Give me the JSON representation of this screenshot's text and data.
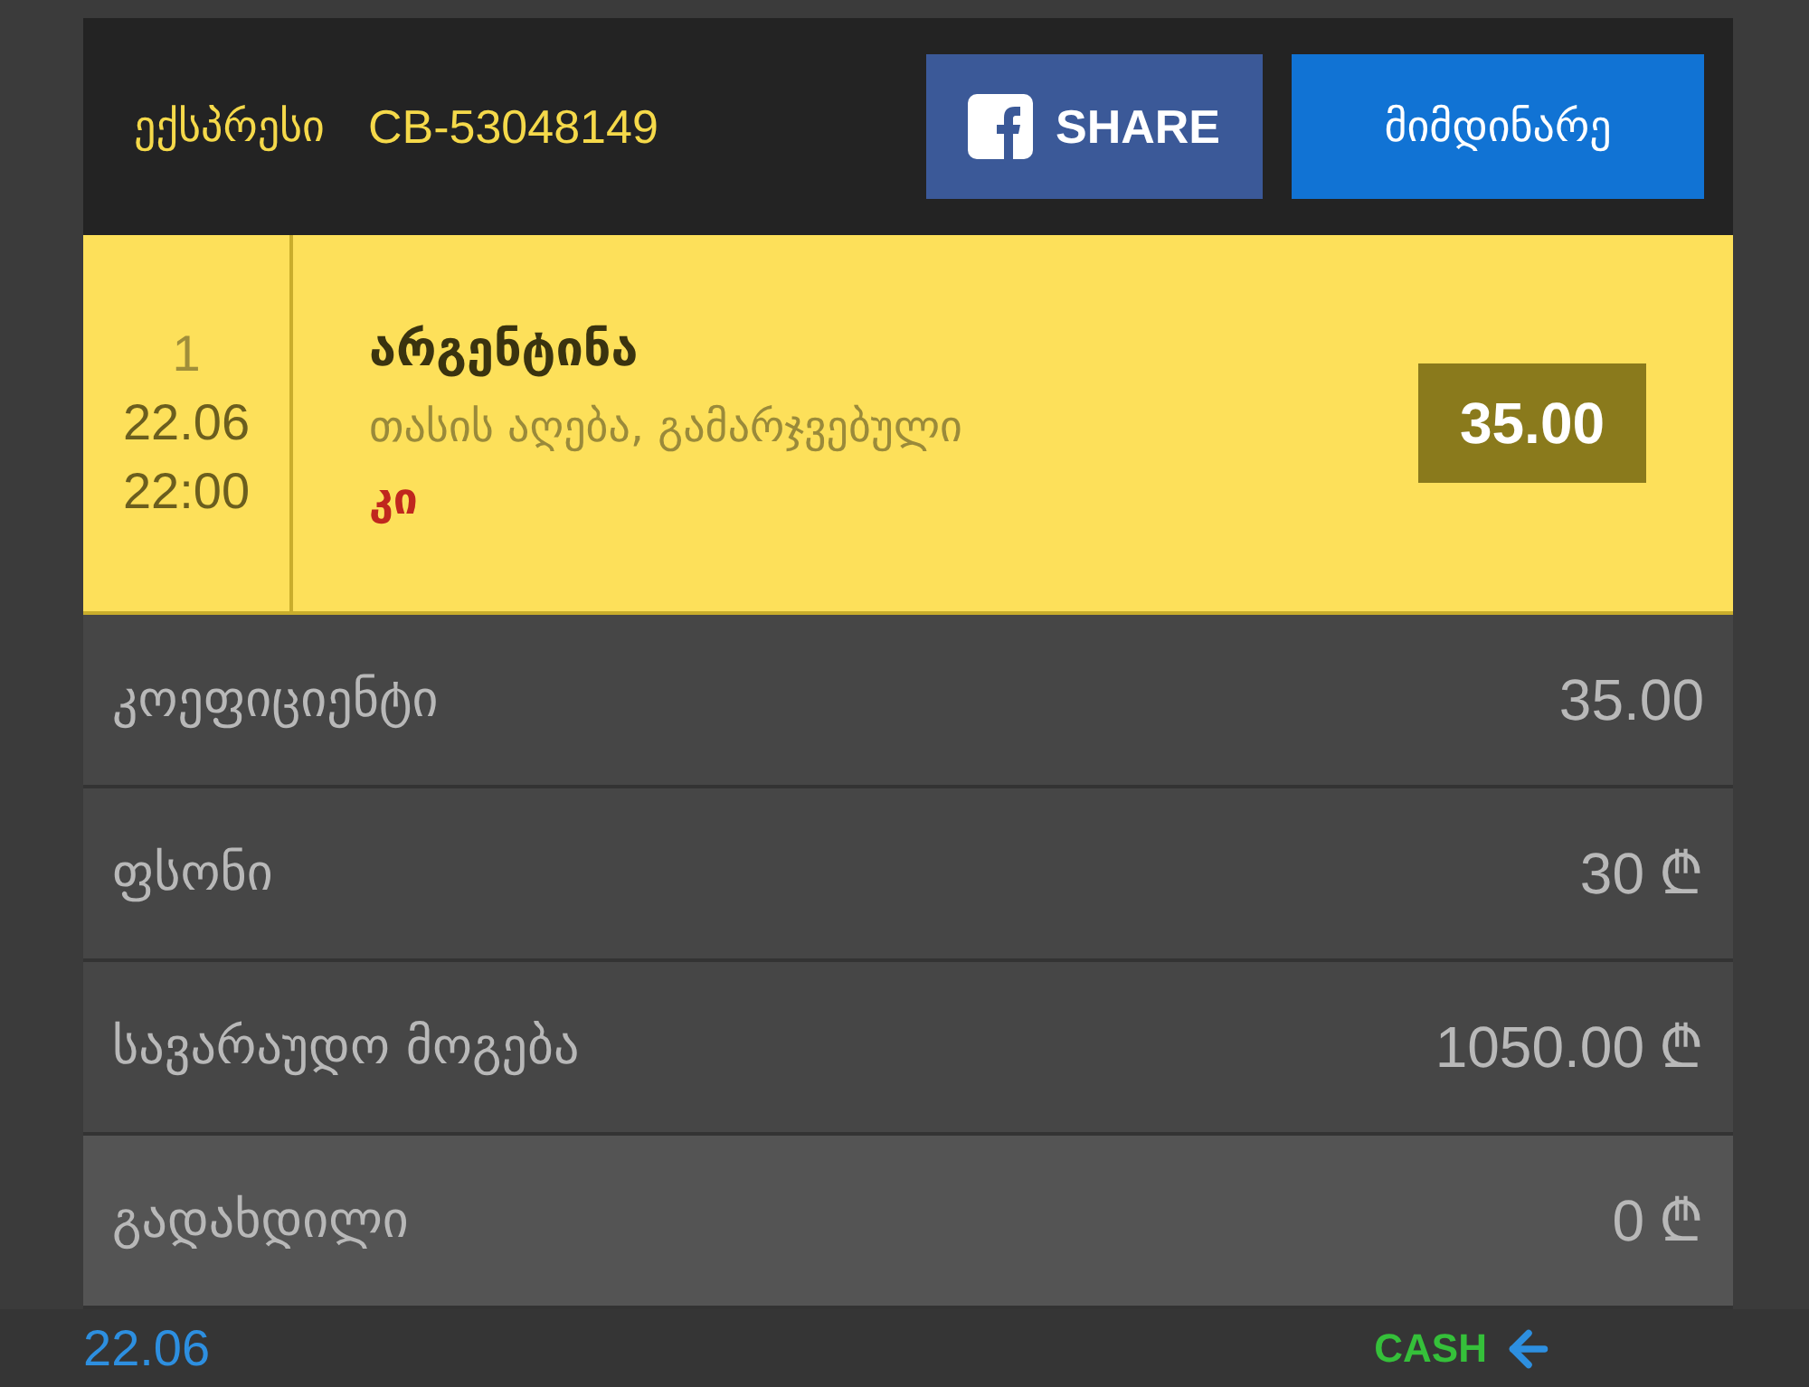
{
  "header": {
    "bet_type": "ექსპრესი",
    "bet_code": "CB-53048149",
    "share_button": "SHARE",
    "status_button": "მიმდინარე"
  },
  "event": {
    "number": "1",
    "date": "22.06",
    "time": "22:00",
    "team": "არგენტინა",
    "market": "თასის აღება, გამარჯვებული",
    "pick": "კი",
    "odds": "35.00"
  },
  "summary_rows": [
    {
      "label": "კოეფიციენტი",
      "value": "35.00",
      "currency": "",
      "highlighted": false
    },
    {
      "label": "ფსონი",
      "value": "30",
      "currency": "₾",
      "highlighted": false
    },
    {
      "label": "სავარაუდო მოგება",
      "value": "1050.00",
      "currency": "₾",
      "highlighted": false
    },
    {
      "label": "გადახდილი",
      "value": "0",
      "currency": "₾",
      "highlighted": true
    }
  ],
  "footer": {
    "date": "22.06",
    "cash_label": "CASH"
  }
}
